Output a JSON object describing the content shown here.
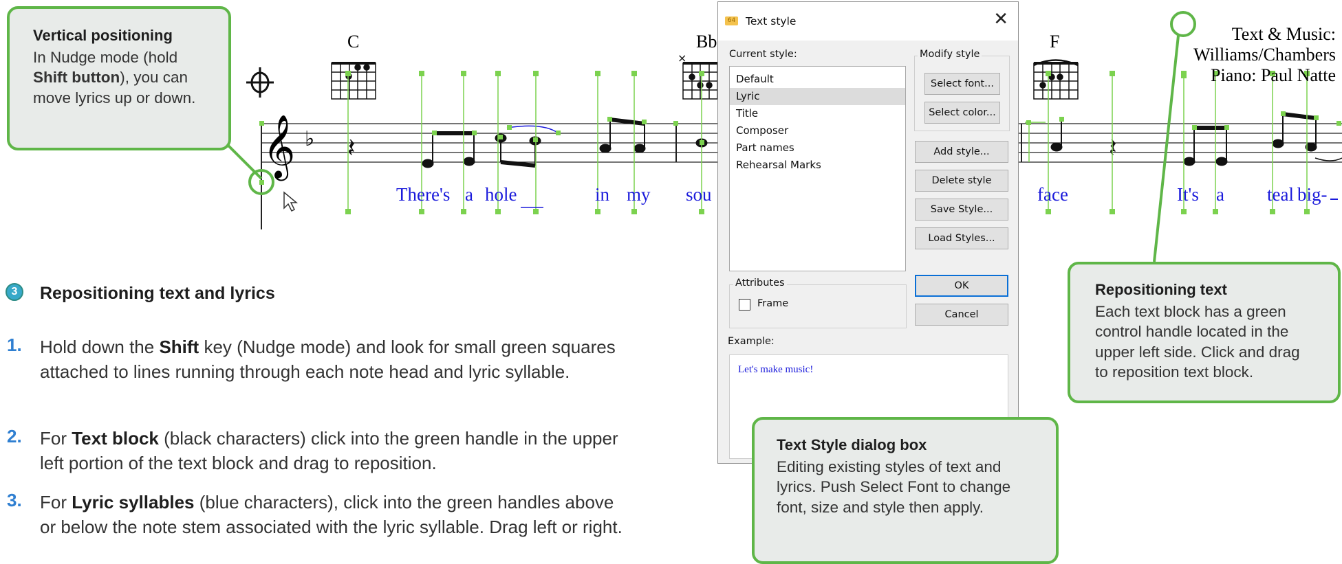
{
  "score": {
    "chords": [
      "C",
      "Bb",
      "F"
    ],
    "credits": [
      "Text & Music:",
      "Williams/Chambers",
      "Piano: Paul Natte"
    ],
    "lyrics": [
      "There's",
      "a",
      "hole",
      "in",
      "my",
      "sou",
      "face",
      "It's",
      "a",
      "teal",
      "big-"
    ]
  },
  "callouts": {
    "vertical": {
      "title": "Vertical positioning",
      "text_a": "In Nudge mode (hold ",
      "text_bold": "Shift button",
      "text_b": "), you can move lyrics up or down."
    },
    "repositioning_text": {
      "title": "Repositioning text",
      "text": "Each text block has a green control handle located in the upper left side. Click and drag to reposition text block."
    },
    "dialog_box": {
      "title": "Text Style dialog box",
      "text": "Editing existing styles of text and lyrics. Push Select Font to change font, size and style then apply."
    }
  },
  "instructions": {
    "badge": "3",
    "title": "Repositioning text and lyrics",
    "steps": [
      {
        "num": "1.",
        "a": "Hold down the ",
        "b": "Shift",
        "c": " key (Nudge mode) and look for small green squares attached to lines running through each note head and lyric syllable."
      },
      {
        "num": "2.",
        "a": "For ",
        "b": "Text block",
        "c": " (black characters) click into the green handle in the upper left portion of the text block and drag to reposition."
      },
      {
        "num": "3.",
        "a": "For ",
        "b": "Lyric syllables",
        "c": " (blue characters), click into the green handles above or below the note stem associated with the lyric syllable. Drag left or right."
      }
    ]
  },
  "dialog": {
    "title": "Text style",
    "close": "✕",
    "current_style_label": "Current style:",
    "styles": [
      "Default",
      "Lyric",
      "Title",
      "Composer",
      "Part names",
      "Rehearsal Marks"
    ],
    "selected_style": "Lyric",
    "modify_label": "Modify style",
    "select_font": "Select font...",
    "select_color": "Select color...",
    "add_style": "Add style...",
    "delete_style": "Delete style",
    "save_style": "Save Style...",
    "load_styles": "Load Styles...",
    "attributes_label": "Attributes",
    "frame_label": "Frame",
    "frame_checked": false,
    "ok": "OK",
    "cancel": "Cancel",
    "example_label": "Example:",
    "example_text": "Let's make music!"
  },
  "colors": {
    "accent_green": "#5fb648",
    "lyric_blue": "#1a1adb",
    "step_blue": "#2f7fd1",
    "callout_bg": "#e8ebe9"
  }
}
